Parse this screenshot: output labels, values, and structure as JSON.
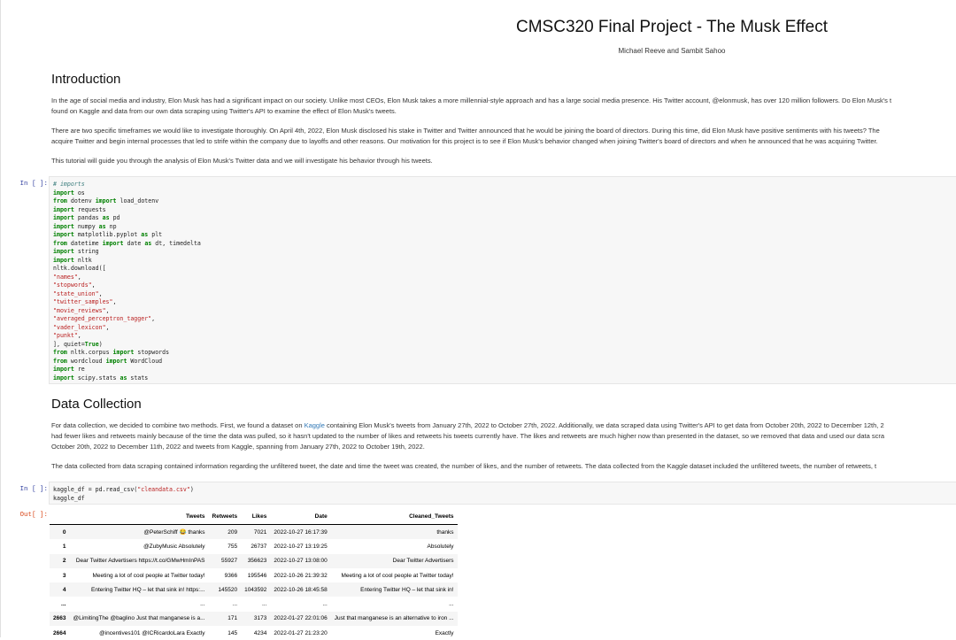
{
  "header": {
    "title": "CMSC320 Final Project - The Musk Effect",
    "authors": "Michael Reeve and Sambit Sahoo"
  },
  "intro": {
    "heading": "Introduction",
    "p1_line1": "In the age of social media and industry, Elon Musk has had a significant impact on our society. Unlike most CEOs, Elon Musk takes a more millennial-style approach and has a large social media presence. His Twitter account, @elonmusk, has over 120 million followers. Do Elon Musk's t",
    "p1_line2": "found on Kaggle and data from our own data scraping using Twitter's API to examine the effect of Elon Musk's tweets.",
    "p2_line1": "There are two specific timeframes we would like to investigate thoroughly. On April 4th, 2022, Elon Musk disclosed his stake in Twitter and Twitter announced that he would be joining the board of directors. During this time, did Elon Musk have positive sentiments with his tweets? The",
    "p2_line2": "acquire Twitter and begin internal processes that led to strife within the company due to layoffs and other reasons. Our motivation for this project is to see if Elon Musk's behavior changed when joining Twitter's board of directors and when he announced that he was acquiring Twitter.",
    "p3": "This tutorial will guide you through the analysis of Elon Musk's Twitter data and we will investigate his behavior through his tweets."
  },
  "cell1": {
    "prompt": "In [ ]:",
    "lines": [
      "# imports",
      "import os",
      "from dotenv import load_dotenv",
      "import requests",
      "import pandas as pd",
      "import numpy as np",
      "import matplotlib.pyplot as plt",
      "from datetime import date as dt, timedelta",
      "import string",
      "import nltk",
      "nltk.download([",
      "\"names\",",
      "\"stopwords\",",
      "\"state_union\",",
      "\"twitter_samples\",",
      "\"movie_reviews\",",
      "\"averaged_perceptron_tagger\",",
      "\"vader_lexicon\",",
      "\"punkt\",",
      "], quiet=True)",
      "from nltk.corpus import stopwords",
      "from wordcloud import WordCloud",
      "import re",
      "import scipy.stats as stats"
    ]
  },
  "datacol": {
    "heading": "Data Collection",
    "p1_line1_a": "For data collection, we decided to combine two methods. First, we found a dataset on ",
    "p1_link": "Kaggle",
    "p1_line1_b": " containing Elon Musk's tweets from January 27th, 2022 to October 27th, 2022. Additionally, we data scraped data using Twitter's API to get data from October 20th, 2022 to December 12th, 2",
    "p1_line2": "had fewer likes and retweets mainly because of the time the data was pulled, so it hasn't updated to the number of likes and retweets his tweets currently have. The likes and retweets are much higher now than presented in the dataset, so we removed that data and used our data scra",
    "p1_line3": "October 20th, 2022 to December 11th, 2022 and tweets from Kaggle, spanning from January 27th, 2022 to October 19th, 2022.",
    "p2": "The data collected from data scraping contained information regarding the unfiltered tweet, the date and time the tweet was created, the number of likes, and the number of retweets. The data collected from the Kaggle dataset included the unfiltered tweets, the number of retweets, t"
  },
  "cell2": {
    "prompt": "In [ ]:",
    "line1_a": "kaggle_df = pd.read_csv(",
    "line1_s": "\"cleandata.csv\"",
    "line1_b": ")",
    "line2": "kaggle_df"
  },
  "output": {
    "prompt": "Out[ ]:",
    "columns": [
      "",
      "Tweets",
      "Retweets",
      "Likes",
      "Date",
      "Cleaned_Tweets"
    ],
    "rows": [
      [
        "0",
        "@PeterSchiff 😂 thanks",
        "209",
        "7021",
        "2022-10-27 16:17:39",
        "thanks"
      ],
      [
        "1",
        "@ZubyMusic Absolutely",
        "755",
        "26737",
        "2022-10-27 13:19:25",
        "Absolutely"
      ],
      [
        "2",
        "Dear Twitter Advertisers https://t.co/GMwHmInPAS",
        "55927",
        "356623",
        "2022-10-27 13:08:00",
        "Dear Twitter Advertisers"
      ],
      [
        "3",
        "Meeting a lot of cool people at Twitter today!",
        "9366",
        "195546",
        "2022-10-26 21:39:32",
        "Meeting a lot of cool people at Twitter today!"
      ],
      [
        "4",
        "Entering Twitter HQ – let that sink in! https:...",
        "145520",
        "1043592",
        "2022-10-26 18:45:58",
        "Entering Twitter HQ – let that sink in!"
      ],
      [
        "...",
        "...",
        "...",
        "...",
        "...",
        "..."
      ],
      [
        "2663",
        "@LimitingThe @baglino Just that manganese is a...",
        "171",
        "3173",
        "2022-01-27 22:01:06",
        "Just that manganese is an alternative to iron ..."
      ],
      [
        "2664",
        "@incentives101 @ICRicardoLara Exactly",
        "145",
        "4234",
        "2022-01-27 21:23:20",
        "Exactly"
      ]
    ]
  }
}
